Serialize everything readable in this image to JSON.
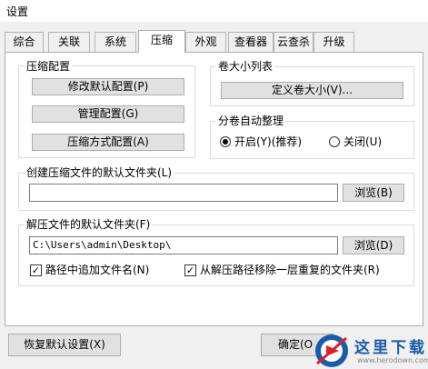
{
  "window": {
    "title": "设置"
  },
  "tabs": [
    {
      "label": "综合"
    },
    {
      "label": "关联"
    },
    {
      "label": "系统"
    },
    {
      "label": "压缩"
    },
    {
      "label": "外观"
    },
    {
      "label": "查看器"
    },
    {
      "label": "云查杀"
    },
    {
      "label": "升级"
    }
  ],
  "active_tab": "压缩",
  "compression_config": {
    "title": "压缩配置",
    "modify_default": "修改默认配置(P)",
    "manage": "管理配置(G)",
    "method": "压缩方式配置(A)"
  },
  "volume_size": {
    "title": "卷大小列表",
    "define": "定义卷大小(V)..."
  },
  "auto_organize": {
    "title": "分卷自动整理",
    "on_label": "开启(Y)(推荐)",
    "off_label": "关闭(U)",
    "selected": "on"
  },
  "default_folder": {
    "title": "创建压缩文件的默认文件夹(L)",
    "value": "",
    "browse": "浏览(B)"
  },
  "extract_folder": {
    "title": "解压文件的默认文件夹(F)",
    "value": "C:\\Users\\admin\\Desktop\\",
    "browse": "浏览(D)",
    "append_name_label": "路径中追加文件名(N)",
    "append_name_checked": true,
    "remove_dup_label": "从解压路径移除一层重复的文件夹(R)",
    "remove_dup_checked": true
  },
  "footer": {
    "restore": "恢复默认设置(X)",
    "ok": "确定(O"
  },
  "watermark": {
    "text": "这里下载",
    "url": "www.herodown.com"
  }
}
